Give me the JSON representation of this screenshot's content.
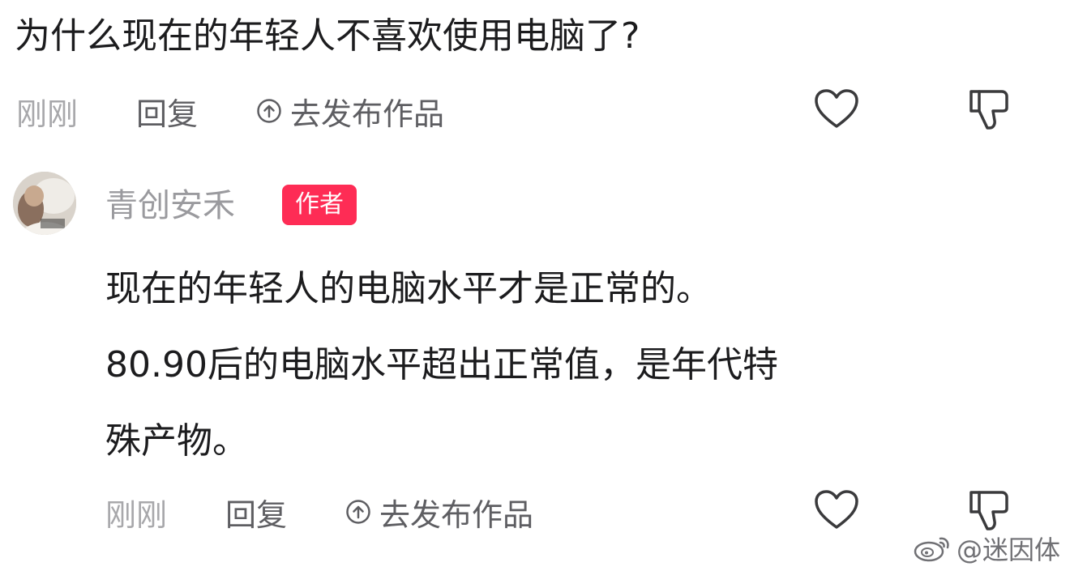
{
  "top_comment": {
    "text": "为什么现在的年轻人不喜欢使用电脑了?",
    "time": "刚刚",
    "reply_label": "回复",
    "publish_label": "去发布作品",
    "like_icon": "heart-outline-icon",
    "dislike_icon": "thumbs-down-icon"
  },
  "reply": {
    "author": "青创安禾",
    "badge": "作者",
    "badge_color": "#fe2c55",
    "lines": [
      "现在的年轻人的电脑水平才是正常的。",
      "80.90后的电脑水平超出正常值，是年代特",
      "殊产物。"
    ],
    "time": "刚刚",
    "reply_label": "回复",
    "publish_label": "去发布作品",
    "like_icon": "heart-outline-icon",
    "dislike_icon": "thumbs-down-icon"
  },
  "watermark": {
    "text": "@迷因体",
    "icon": "weibo-logo-icon"
  }
}
